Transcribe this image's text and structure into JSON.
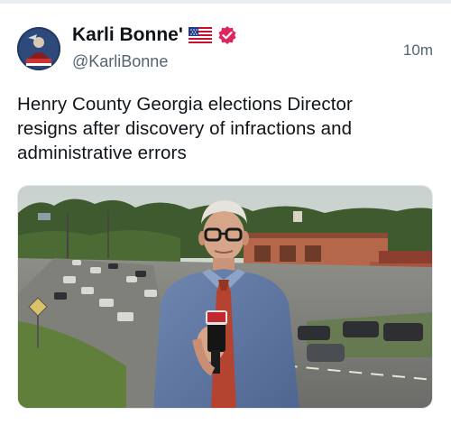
{
  "post": {
    "author": {
      "display_name": "Karli Bonne'",
      "handle": "@KarliBonne",
      "flag_icon": "us-flag-icon",
      "verified_icon": "verified-badge-icon",
      "verified_color": "#e0245e"
    },
    "timestamp": "10m",
    "text": "Henry County Georgia elections Director resigns after discovery of infractions and administrative errors",
    "media": {
      "type": "video-still",
      "description_icon": "news-report-image"
    }
  },
  "colors": {
    "text_primary": "#0f1419",
    "text_secondary": "#536471"
  }
}
